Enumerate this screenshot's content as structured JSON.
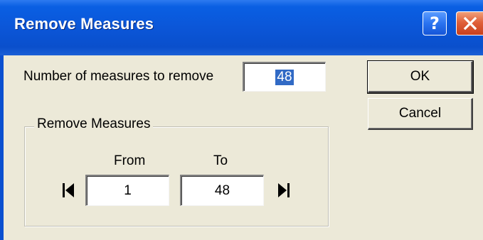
{
  "window": {
    "title": "Remove Measures",
    "help_icon": "help-icon",
    "help_glyph": "?",
    "close_icon": "close-icon"
  },
  "number_of_measures": {
    "label": "Number of measures to remove",
    "value": "48"
  },
  "buttons": {
    "ok_label": "OK",
    "cancel_label": "Cancel"
  },
  "range_group": {
    "title": "Remove Measures",
    "from_label": "From",
    "to_label": "To",
    "from_value": "1",
    "to_value": "48",
    "first_icon": "go-to-first-icon",
    "last_icon": "go-to-last-icon"
  },
  "colors": {
    "title_bar": "#0b56d8",
    "dialog_background": "#ece9d8",
    "selection": "#316ac5",
    "close_button": "#e0603a"
  }
}
